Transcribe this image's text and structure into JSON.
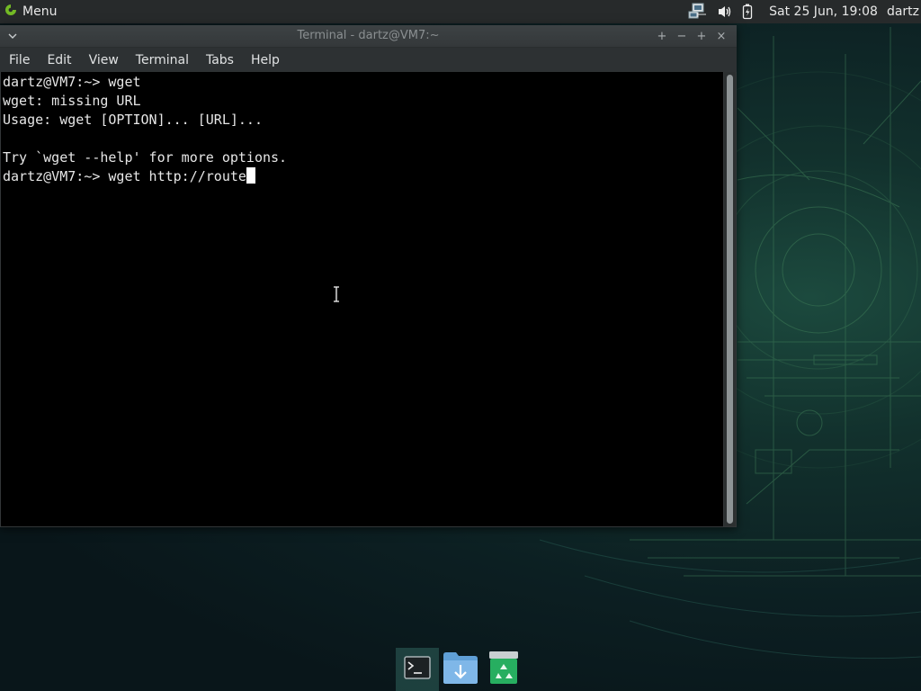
{
  "top_panel": {
    "menu_label": "Menu",
    "clock": "Sat 25 Jun, 19:08",
    "user": "dartz",
    "tray_icons": [
      "network-icon",
      "volume-icon",
      "battery-icon"
    ]
  },
  "window": {
    "title": "Terminal - dartz@VM7:~",
    "controls": [
      "+",
      "−",
      "+",
      "×"
    ],
    "menu": [
      "File",
      "Edit",
      "View",
      "Terminal",
      "Tabs",
      "Help"
    ]
  },
  "terminal": {
    "lines": [
      "dartz@VM7:~> wget",
      "wget: missing URL",
      "Usage: wget [OPTION]... [URL]...",
      "",
      "Try `wget --help' for more options."
    ],
    "prompt_line": "dartz@VM7:~> wget http://route"
  },
  "dock": {
    "items": [
      "terminal-icon",
      "downloads-folder-icon",
      "recycle-bin-icon"
    ]
  },
  "colors": {
    "panel": "#272a2b",
    "terminal_bg": "#000000",
    "terminal_fg": "#e6e6e6",
    "accent_green": "#73ba25"
  }
}
